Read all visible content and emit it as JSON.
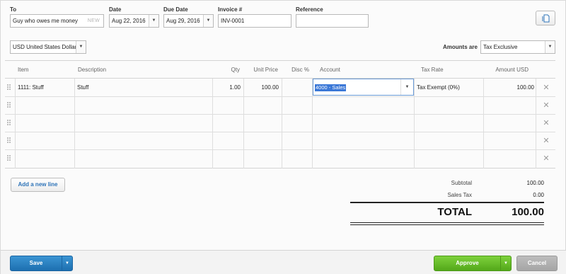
{
  "header": {
    "to_label": "To",
    "to_value": "Guy who owes me money",
    "to_hint": "NEW",
    "date_label": "Date",
    "date_value": "Aug 22, 2016",
    "due_label": "Due Date",
    "due_value": "Aug 29, 2016",
    "invoice_label": "Invoice #",
    "invoice_value": "INV-0001",
    "reference_label": "Reference",
    "reference_value": ""
  },
  "currency": {
    "value": "USD United States Dollar"
  },
  "amounts": {
    "label": "Amounts are",
    "value": "Tax Exclusive"
  },
  "table": {
    "columns": {
      "item": "Item",
      "description": "Description",
      "qty": "Qty",
      "unit_price": "Unit Price",
      "disc": "Disc %",
      "account": "Account",
      "tax_rate": "Tax Rate",
      "amount": "Amount USD"
    },
    "rows": [
      {
        "item": "1111: Stuff",
        "description": "Stuff",
        "qty": "1.00",
        "unit_price": "100.00",
        "disc": "",
        "account": "4000 - Sales",
        "tax_rate": "Tax Exempt (0%)",
        "amount": "100.00"
      }
    ]
  },
  "actions": {
    "add_line": "Add a new line"
  },
  "totals": {
    "subtotal_label": "Subtotal",
    "subtotal_value": "100.00",
    "tax_label": "Sales Tax",
    "tax_value": "0.00",
    "total_label": "TOTAL",
    "total_value": "100.00"
  },
  "footer": {
    "save": "Save",
    "approve": "Approve",
    "cancel": "Cancel"
  },
  "icons": {
    "copy": "copy-icon",
    "dropdown": "chevron-down-icon",
    "delete": "close-icon",
    "drag": "drag-handle-icon"
  }
}
